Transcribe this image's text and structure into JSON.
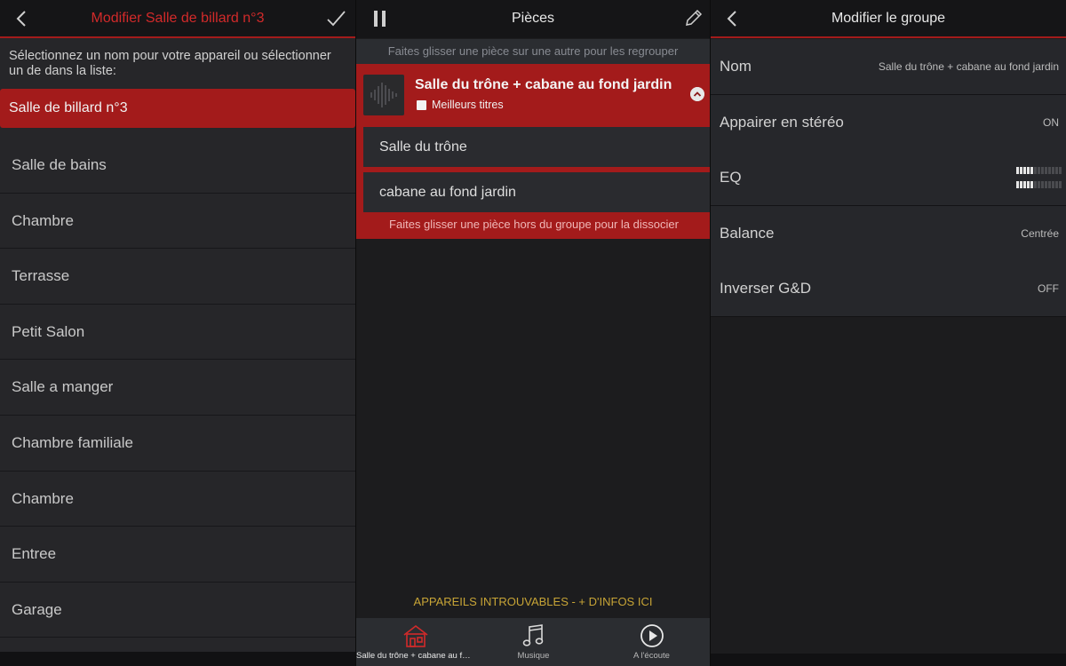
{
  "left": {
    "title": "Modifier Salle de billard n°3",
    "instruction": "Sélectionnez un nom pour votre appareil ou sélectionner un de dans la liste:",
    "selected": "Salle de billard n°3",
    "rooms": [
      "Salle de bains",
      "Chambre",
      "Terrasse",
      "Petit Salon",
      "Salle a manger",
      "Chambre familiale",
      "Chambre",
      "Entree",
      "Garage"
    ]
  },
  "middle": {
    "title": "Pièces",
    "hint_top": "Faites glisser une pièce sur une autre pour les regrouper",
    "group_title": "Salle du trône + cabane au fond jardin",
    "best_titles": "Meilleurs titres",
    "sub_rooms": [
      "Salle du trône",
      "cabane au fond jardin"
    ],
    "hint_bottom": "Faites glisser une pièce hors du groupe pour la dissocier",
    "not_found": "APPAREILS INTROUVABLES - + D'INFOS ICI",
    "tabs": [
      {
        "label": "Salle du trône + cabane au fond jardin",
        "icon": "house-icon"
      },
      {
        "label": "Musique",
        "icon": "music-note-icon"
      },
      {
        "label": "A l'écoute",
        "icon": "play-circle-icon"
      }
    ]
  },
  "right": {
    "title": "Modifier le groupe",
    "settings": [
      {
        "label": "Nom",
        "value": "Salle du trône + cabane au fond jardin"
      },
      {
        "label": "Appairer en stéréo",
        "value": "ON"
      },
      {
        "label": "EQ",
        "value": ""
      },
      {
        "label": "Balance",
        "value": "Centrée"
      },
      {
        "label": "Inverser G&D",
        "value": "OFF"
      }
    ]
  },
  "colors": {
    "accent": "#a31b1b",
    "accent_text": "#d22a2a",
    "warning": "#c7a436"
  }
}
